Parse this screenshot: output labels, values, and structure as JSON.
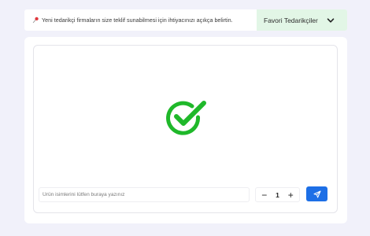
{
  "notice": {
    "icon": "pin-icon",
    "text": "Yeni tedarikçi firmaların size teklif sunabilmesi için ihtiyacınızı açıkça belirtin."
  },
  "favorites": {
    "label": "Favori Tedarikçiler",
    "icon": "chevron-down-icon",
    "bg_color": "#e2f6e6"
  },
  "status": {
    "icon": "check-circle-icon",
    "color": "#1fb82a"
  },
  "product_input": {
    "placeholder": "Ürün isimlerini lütfen buraya yazınız",
    "value": ""
  },
  "quantity": {
    "minus": "−",
    "value": "1",
    "plus": "+"
  },
  "send_button": {
    "icon": "send-icon",
    "color": "#1d6fe6"
  }
}
